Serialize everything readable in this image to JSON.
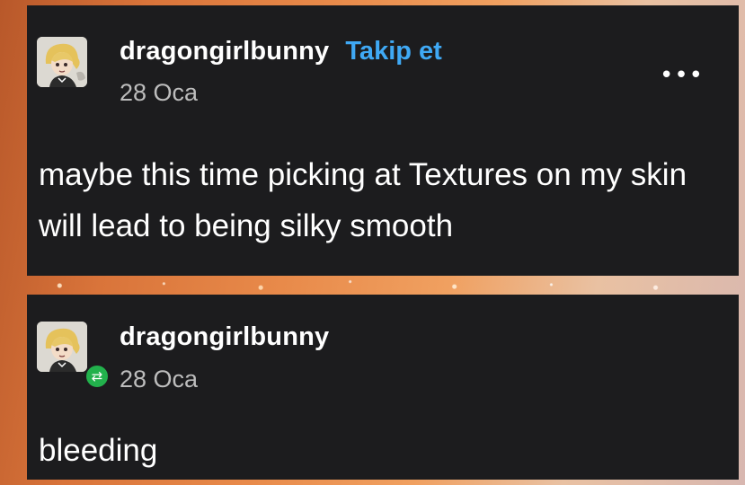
{
  "original_post": {
    "username": "dragongirlbunny",
    "follow_label": "Takip et",
    "date": "28 Oca",
    "more_icon": "more-horizontal-icon",
    "text": "maybe this time picking at Textures on my skin will lead to being silky smooth"
  },
  "reblog": {
    "username": "dragongirlbunny",
    "date": "28 Oca",
    "badge_icon": "reblog-icon",
    "badge_color": "#22b14c",
    "text": "bleeding"
  },
  "colors": {
    "card_bg": "#1c1c1e",
    "follow": "#3fa9f5",
    "date": "#bdbdbd"
  }
}
